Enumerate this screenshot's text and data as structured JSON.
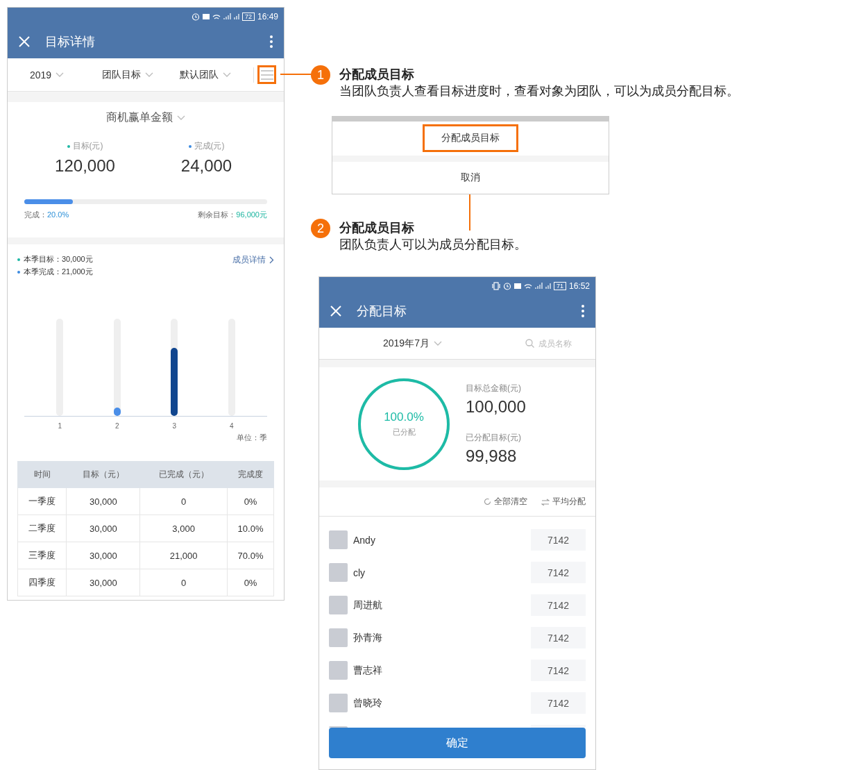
{
  "screen_1": {
    "status_bar": {
      "battery": "72",
      "time": "16:49"
    },
    "app_bar": {
      "title": "目标详情"
    },
    "filters": [
      {
        "label": "2019"
      },
      {
        "label": "团队目标"
      },
      {
        "label": "默认团队"
      }
    ],
    "menu_button": {
      "highlighted": true
    },
    "metric": {
      "label": "商机赢单金额"
    },
    "stats": [
      {
        "label": "目标(元)",
        "value": "120,000",
        "color": "#1fb8a5"
      },
      {
        "label": "完成(元)",
        "value": "24,000",
        "color": "#3d8be0"
      }
    ],
    "progress": {
      "level": 0.2,
      "done_label": "完成：",
      "done_value": "20.0%",
      "remain_label": "剩余目标：",
      "remain_value": "96,000元"
    },
    "quarter": {
      "legend": [
        {
          "text": "本季目标：30,000元",
          "color": "#1fb8a5"
        },
        {
          "text": "本季完成：21,000元",
          "color": "#3d8be0"
        }
      ],
      "link": "成员详情",
      "bars": [
        {
          "label": "1"
        },
        {
          "label": "2",
          "level": 0.08,
          "color": "#4a8ee8"
        },
        {
          "label": "3",
          "level": 0.7,
          "color": "#11468f"
        },
        {
          "label": "4"
        }
      ],
      "unit": "单位：季"
    },
    "table": {
      "columns": [
        "时间",
        "目标（元）",
        "已完成（元）",
        "完成度"
      ],
      "rows": [
        [
          "一季度",
          "30,000",
          "0",
          "0%"
        ],
        [
          "二季度",
          "30,000",
          "3,000",
          "10.0%"
        ],
        [
          "三季度",
          "30,000",
          "21,000",
          "70.0%"
        ],
        [
          "四季度",
          "30,000",
          "0",
          "0%"
        ]
      ]
    }
  },
  "annotations": [
    {
      "number": "1",
      "title": "分配成员目标",
      "text": "当团队负责人查看目标进度时，查看对象为团队，可以为成员分配目标。"
    },
    {
      "number": "2",
      "title": "分配成员目标",
      "text": "团队负责人可以为成员分配目标。"
    }
  ],
  "action_sheet": {
    "items": [
      {
        "label": "分配成员目标",
        "highlighted": true
      },
      {
        "label": "取消",
        "highlighted": false
      }
    ]
  },
  "screen_2": {
    "status_bar": {
      "battery": "71",
      "time": "16:52"
    },
    "app_bar": {
      "title": "分配目标"
    },
    "month": "2019年7月",
    "search": {
      "placeholder": "成员名称"
    },
    "ring": {
      "level": 1,
      "percent": "100.0%",
      "caption": "已分配"
    },
    "total": {
      "label": "目标总金额(元)",
      "value": "100,000"
    },
    "allocated": {
      "label": "已分配目标(元)",
      "value": "99,988"
    },
    "actions": [
      {
        "kind": "clear",
        "label": "全部清空"
      },
      {
        "kind": "even",
        "label": "平均分配"
      }
    ],
    "members": [
      {
        "name": "Andy",
        "value": "7142"
      },
      {
        "name": "cly",
        "value": "7142"
      },
      {
        "name": "周进航",
        "value": "7142"
      },
      {
        "name": "孙青海",
        "value": "7142"
      },
      {
        "name": "曹志祥",
        "value": "7142"
      },
      {
        "name": "曾晓玲",
        "value": "7142"
      }
    ],
    "confirm": "确定"
  }
}
